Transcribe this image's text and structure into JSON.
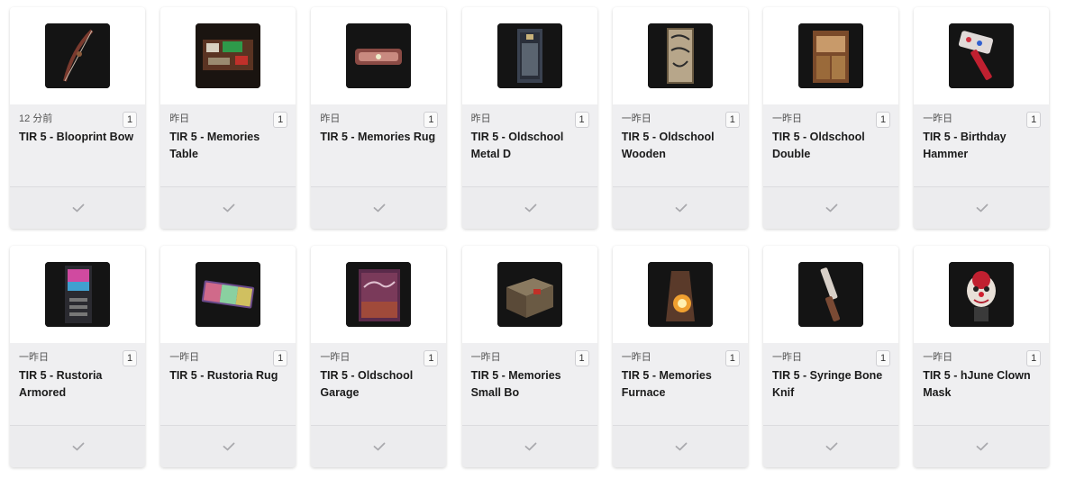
{
  "items": [
    {
      "time": "12 分前",
      "count": "1",
      "title": "TIR 5 - Blooprint Bow",
      "icon": "bow-icon"
    },
    {
      "time": "昨日",
      "count": "1",
      "title": "TIR 5 - Memories Table",
      "icon": "table-icon"
    },
    {
      "time": "昨日",
      "count": "1",
      "title": "TIR 5 - Memories Rug",
      "icon": "rug-icon"
    },
    {
      "time": "昨日",
      "count": "1",
      "title": "TIR 5 - Oldschool Metal D",
      "icon": "metal-door-icon"
    },
    {
      "time": "一昨日",
      "count": "1",
      "title": "TIR 5 - Oldschool Wooden",
      "icon": "wooden-door-icon"
    },
    {
      "time": "一昨日",
      "count": "1",
      "title": "TIR 5 - Oldschool Double",
      "icon": "double-door-icon"
    },
    {
      "time": "一昨日",
      "count": "1",
      "title": "TIR 5 - Birthday Hammer",
      "icon": "hammer-icon"
    },
    {
      "time": "一昨日",
      "count": "1",
      "title": "TIR 5 - Rustoria Armored",
      "icon": "armored-door-icon"
    },
    {
      "time": "一昨日",
      "count": "1",
      "title": "TIR 5 - Rustoria Rug",
      "icon": "rainbow-rug-icon"
    },
    {
      "time": "一昨日",
      "count": "1",
      "title": "TIR 5 - Oldschool Garage",
      "icon": "garage-door-icon"
    },
    {
      "time": "一昨日",
      "count": "1",
      "title": "TIR 5 - Memories Small Bo",
      "icon": "small-box-icon"
    },
    {
      "time": "一昨日",
      "count": "1",
      "title": "TIR 5 - Memories Furnace",
      "icon": "furnace-icon"
    },
    {
      "time": "一昨日",
      "count": "1",
      "title": "TIR 5 - Syringe Bone Knif",
      "icon": "bone-knife-icon"
    },
    {
      "time": "一昨日",
      "count": "1",
      "title": "TIR 5 - hJune Clown Mask",
      "icon": "clown-mask-icon"
    }
  ]
}
